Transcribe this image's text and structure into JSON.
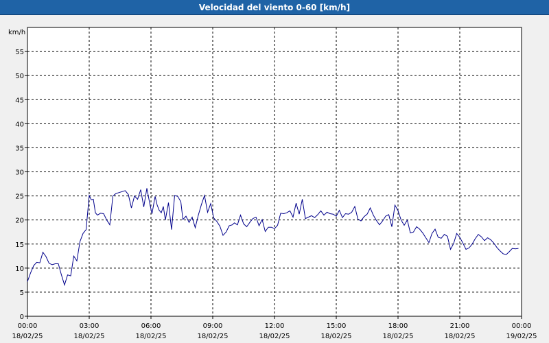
{
  "title": "Velocidad del viento 0-60 [km/h]",
  "chart_data": {
    "type": "line",
    "title": "Velocidad del viento 0-60 [km/h]",
    "ylabel": "km/h",
    "ylim": [
      0,
      60
    ],
    "yticks": [
      0,
      5,
      10,
      15,
      20,
      25,
      30,
      35,
      40,
      45,
      50,
      55
    ],
    "xlim_hours": [
      0,
      24
    ],
    "xticks": [
      {
        "hour": 0,
        "time": "00:00",
        "date": "18/02/25"
      },
      {
        "hour": 3,
        "time": "03:00",
        "date": "18/02/25"
      },
      {
        "hour": 6,
        "time": "06:00",
        "date": "18/02/25"
      },
      {
        "hour": 9,
        "time": "09:00",
        "date": "18/02/25"
      },
      {
        "hour": 12,
        "time": "12:00",
        "date": "18/02/25"
      },
      {
        "hour": 15,
        "time": "15:00",
        "date": "18/02/25"
      },
      {
        "hour": 18,
        "time": "18:00",
        "date": "18/02/25"
      },
      {
        "hour": 21,
        "time": "21:00",
        "date": "18/02/25"
      },
      {
        "hour": 24,
        "time": "00:00",
        "date": "19/02/25"
      }
    ],
    "grid": true,
    "line_color": "#00008b",
    "series": [
      {
        "x": [
          0.0,
          0.15,
          0.3,
          0.45,
          0.6,
          0.75,
          0.9,
          1.05,
          1.2,
          1.35,
          1.5,
          1.65,
          1.8,
          1.95,
          2.1,
          2.25,
          2.4,
          2.55,
          2.7,
          2.85,
          3.0,
          3.1,
          3.2,
          3.3,
          3.4,
          3.55,
          3.7,
          3.85,
          4.0,
          4.15,
          4.3,
          4.45,
          4.6,
          4.75,
          4.9,
          5.05,
          5.2,
          5.35,
          5.5,
          5.65,
          5.8,
          5.95,
          6.05,
          6.2,
          6.3,
          6.4,
          6.5,
          6.6,
          6.7,
          6.85,
          7.0,
          7.15,
          7.3,
          7.45,
          7.55,
          7.7,
          7.85,
          8.0,
          8.15,
          8.3,
          8.45,
          8.6,
          8.75,
          8.9,
          9.05,
          9.2,
          9.35,
          9.5,
          9.65,
          9.8,
          9.95,
          10.05,
          10.2,
          10.35,
          10.5,
          10.65,
          10.8,
          10.95,
          11.1,
          11.25,
          11.4,
          11.55,
          11.7,
          11.85,
          12.0,
          12.15,
          12.3,
          12.45,
          12.6,
          12.75,
          12.9,
          13.05,
          13.2,
          13.35,
          13.5,
          13.65,
          13.8,
          13.95,
          14.1,
          14.25,
          14.4,
          14.55,
          14.7,
          14.85,
          15.0,
          15.15,
          15.3,
          15.45,
          15.6,
          15.75,
          15.9,
          16.05,
          16.2,
          16.35,
          16.5,
          16.65,
          16.8,
          16.95,
          17.1,
          17.25,
          17.4,
          17.55,
          17.7,
          17.85,
          18.0,
          18.15,
          18.3,
          18.45,
          18.6,
          18.75,
          18.9,
          19.05,
          19.2,
          19.35,
          19.5,
          19.65,
          19.8,
          19.95,
          20.1,
          20.25,
          20.4,
          20.55,
          20.7,
          20.85,
          21.0,
          21.15,
          21.3,
          21.45,
          21.6,
          21.75,
          21.9,
          22.05,
          22.2,
          22.35,
          22.5,
          22.65,
          22.8,
          22.95,
          23.1,
          23.25,
          23.4,
          23.55,
          23.7,
          23.85
        ],
        "values": [
          7.2,
          9.0,
          10.5,
          11.2,
          11.1,
          13.3,
          12.4,
          11.0,
          10.7,
          10.9,
          10.9,
          8.6,
          6.5,
          8.6,
          8.4,
          12.5,
          11.5,
          15.5,
          17.2,
          18.0,
          25.1,
          24.2,
          24.3,
          21.5,
          21.0,
          21.4,
          21.3,
          20.0,
          19.0,
          25.0,
          25.5,
          25.7,
          25.9,
          26.1,
          25.3,
          22.5,
          25.0,
          24.3,
          26.3,
          22.7,
          26.6,
          23.2,
          21.3,
          24.9,
          23.1,
          22.0,
          21.5,
          22.8,
          20.0,
          23.6,
          18.0,
          25.1,
          24.9,
          23.8,
          20.1,
          20.8,
          19.5,
          20.6,
          18.4,
          21.0,
          23.2,
          25.1,
          21.6,
          23.4,
          20.4,
          19.7,
          18.7,
          16.8,
          17.5,
          18.8,
          19.0,
          19.4,
          19.0,
          21.0,
          19.2,
          18.6,
          19.5,
          20.3,
          20.6,
          18.8,
          20.1,
          17.6,
          18.5,
          18.5,
          18.2,
          18.9,
          21.4,
          21.3,
          21.5,
          21.9,
          20.6,
          23.5,
          21.2,
          24.3,
          20.3,
          20.6,
          20.9,
          20.5,
          21.1,
          21.9,
          21.0,
          21.6,
          21.3,
          21.2,
          20.8,
          22.0,
          20.5,
          21.3,
          21.2,
          21.6,
          22.8,
          20.2,
          19.8,
          20.7,
          21.2,
          22.5,
          21.0,
          19.9,
          19.0,
          19.8,
          20.8,
          21.1,
          18.6,
          23.1,
          21.9,
          20.0,
          18.9,
          20.0,
          17.3,
          17.5,
          18.6,
          18.1,
          17.3,
          16.3,
          15.3,
          17.2,
          18.1,
          16.4,
          16.2,
          17.0,
          16.6,
          13.9,
          15.1,
          17.2,
          16.4,
          15.2,
          13.9,
          14.2,
          15.0,
          16.1,
          17.0,
          16.5,
          15.7,
          16.3,
          15.9,
          15.2,
          14.3,
          13.6,
          13.0,
          12.8,
          13.4,
          14.1,
          14.0,
          14.1
        ]
      }
    ]
  }
}
